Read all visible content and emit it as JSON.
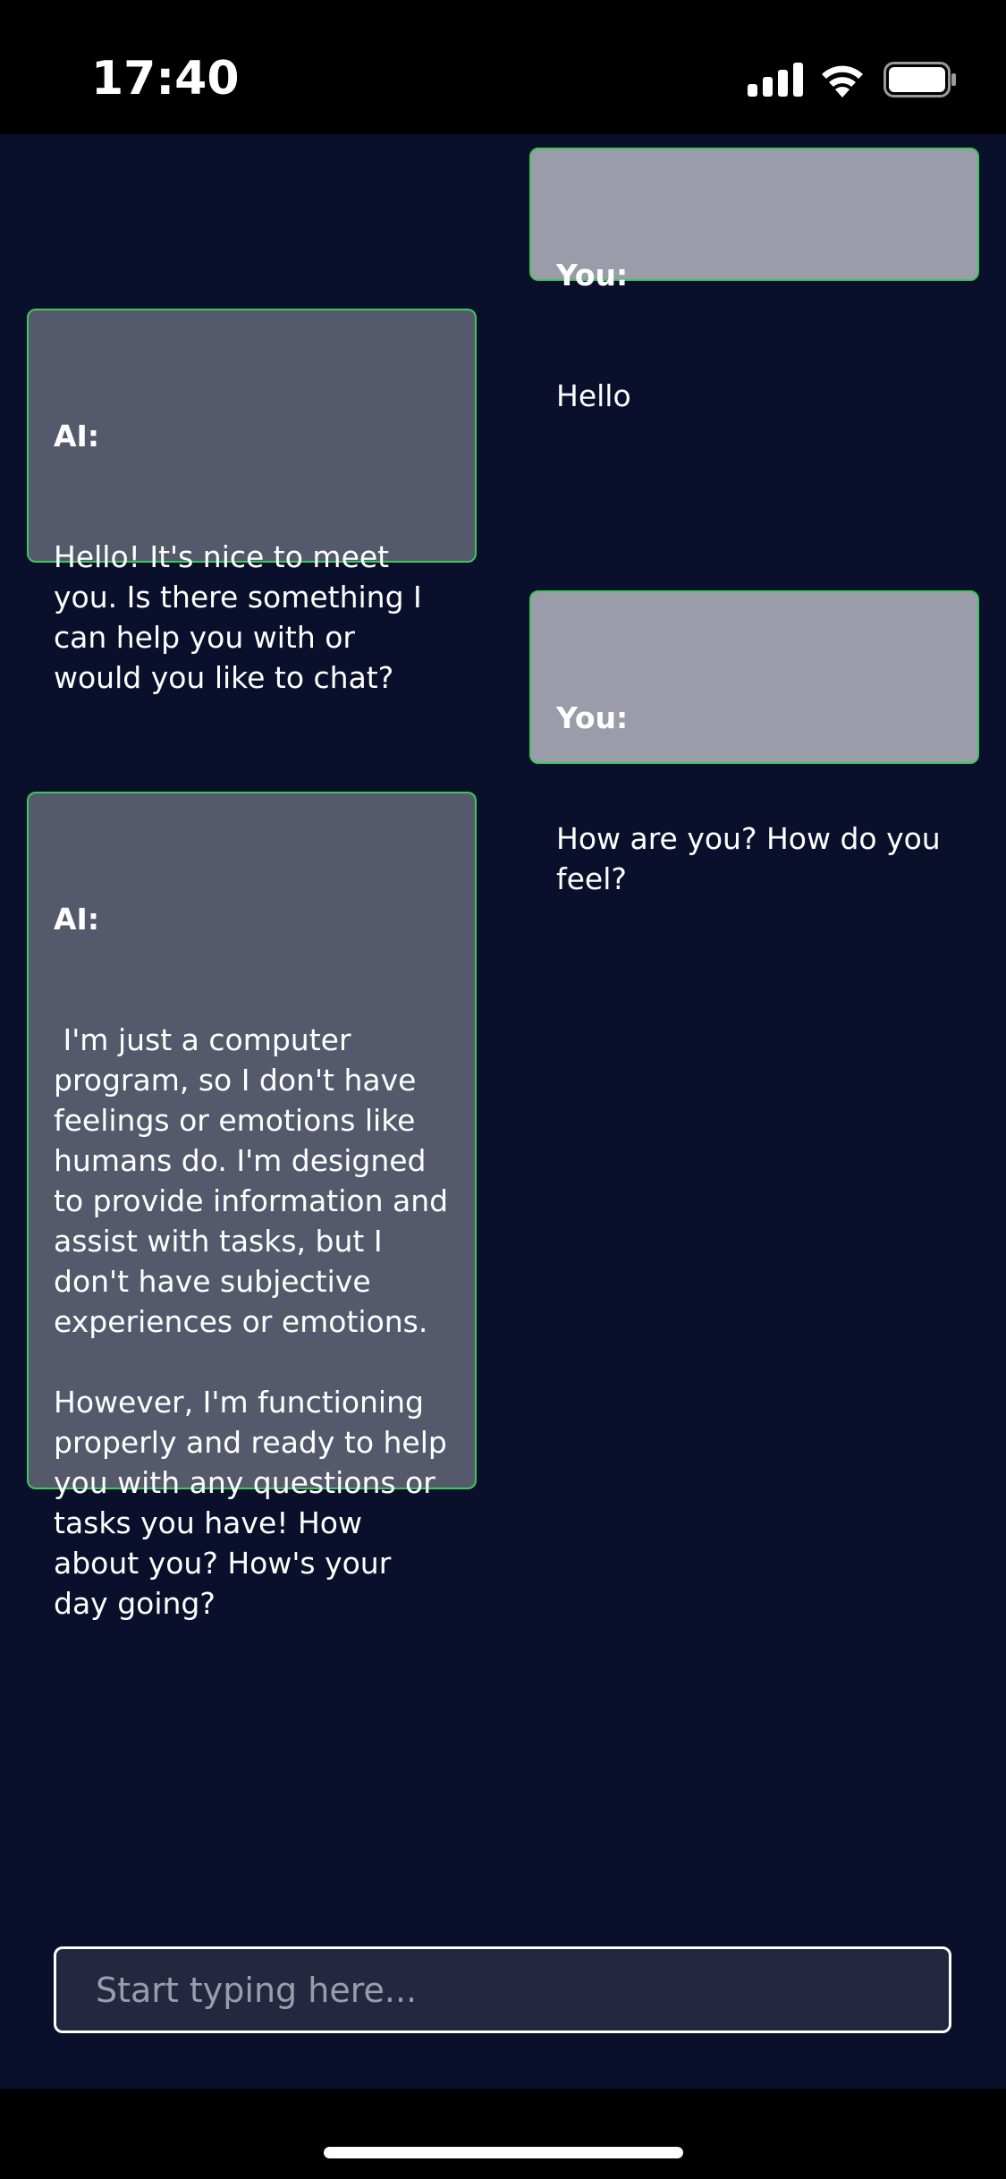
{
  "status_bar": {
    "time": "17:40",
    "signal_icon": "cellular-signal-icon",
    "wifi_icon": "wifi-icon",
    "battery_icon": "battery-icon"
  },
  "colors": {
    "chat_background": "#0a102b",
    "user_bubble": "#9a9da9",
    "ai_bubble": "#545a6b",
    "bubble_border": "#3bc95a",
    "input_background": "#232740"
  },
  "messages": [
    {
      "role": "user",
      "sender": "You:",
      "text": "Hello"
    },
    {
      "role": "ai",
      "sender": "AI:",
      "text": "Hello! It's nice to meet you. Is there something I can help you with or would you like to chat?"
    },
    {
      "role": "user",
      "sender": "You:",
      "text": "How are you? How do you feel?"
    },
    {
      "role": "ai",
      "sender": "AI:",
      "text": " I'm just a computer program, so I don't have feelings or emotions like humans do. I'm designed to provide information and assist with tasks, but I don't have subjective experiences or emotions.\n\nHowever, I'm functioning properly and ready to help you with any questions or tasks you have! How about you? How's your day going?"
    }
  ],
  "input": {
    "placeholder": "Start typing here...",
    "value": ""
  }
}
